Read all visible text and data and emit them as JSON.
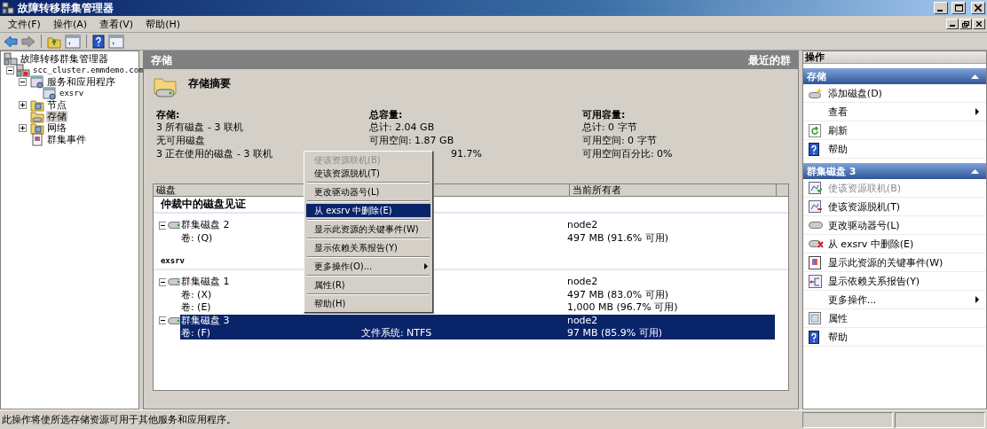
{
  "window": {
    "title": "故障转移群集管理器"
  },
  "menu_bar": [
    "文件(F)",
    "操作(A)",
    "查看(V)",
    "帮助(H)"
  ],
  "tree": [
    {
      "label": "故障转移群集管理器",
      "kind": "manager",
      "selected": false,
      "children": [
        {
          "label": "scc_cluster.emmdemo.com",
          "kind": "cluster",
          "selected": false,
          "expanded": true,
          "children": [
            {
              "label": "服务和应用程序",
              "kind": "services",
              "selected": false,
              "expanded": true,
              "children": [
                {
                  "label": "exsrv",
                  "kind": "service",
                  "selected": false
                }
              ]
            },
            {
              "label": "节点",
              "kind": "nodes",
              "selected": false,
              "expanded": false
            },
            {
              "label": "存储",
              "kind": "storage",
              "selected": true
            },
            {
              "label": "网络",
              "kind": "network",
              "selected": false,
              "expanded": false
            },
            {
              "label": "群集事件",
              "kind": "events",
              "selected": false
            }
          ]
        }
      ]
    }
  ],
  "center": {
    "title": "存储",
    "subtitle": "最近的群",
    "summary_title": "存储摘要",
    "summary_columns": [
      {
        "heading": "存储:",
        "lines": [
          "3 所有磁盘 - 3 联机",
          "无可用磁盘",
          "3 正在使用的磁盘 - 3 联机"
        ]
      },
      {
        "heading": "总容量:",
        "lines": [
          "总计: 2.04 GB",
          "可用空间: 1.87 GB",
          "91.7%"
        ]
      },
      {
        "heading": "可用容量:",
        "lines": [
          "总计: 0 字节",
          "可用空间: 0 字节",
          "可用空间百分比: 0%"
        ]
      }
    ],
    "table": {
      "columns": [
        "磁盘",
        "当前所有者"
      ],
      "groups": [
        {
          "title": "仲裁中的磁盘见证",
          "rows": [
            {
              "kind": "disk",
              "name": "群集磁盘 2",
              "owner": "node2",
              "expanded": true,
              "selected": false
            },
            {
              "kind": "volume",
              "name": "卷: (Q)",
              "owner": "497 MB (91.6% 可用)",
              "selected": false
            }
          ]
        },
        {
          "title": "exsrv",
          "rows": [
            {
              "kind": "disk",
              "name": "群集磁盘 1",
              "owner": "node2",
              "expanded": true,
              "selected": false
            },
            {
              "kind": "volume",
              "name": "卷: (X)",
              "owner": "497 MB (83.0% 可用)",
              "selected": false
            },
            {
              "kind": "volume",
              "name": "卷: (E)",
              "owner": "1,000 MB (96.7% 可用)",
              "selected": false
            },
            {
              "kind": "disk",
              "name": "群集磁盘 3",
              "owner": "node2",
              "expanded": true,
              "selected": true
            },
            {
              "kind": "volume",
              "name": "卷: (F)",
              "status": "文件系统: NTFS",
              "owner": "97 MB (85.9% 可用)",
              "selected": true
            }
          ]
        }
      ]
    }
  },
  "context_menu": [
    [
      {
        "label": "使该资源联机(B)",
        "disabled": true,
        "selected": false,
        "submenu": false
      },
      {
        "label": "使该资源脱机(T)",
        "disabled": false,
        "selected": false,
        "submenu": false
      }
    ],
    [
      {
        "label": "更改驱动器号(L)",
        "disabled": false,
        "selected": false,
        "submenu": false
      }
    ],
    [
      {
        "label": "从 exsrv 中删除(E)",
        "disabled": false,
        "selected": true,
        "submenu": false
      }
    ],
    [
      {
        "label": "显示此资源的关键事件(W)",
        "disabled": false,
        "selected": false,
        "submenu": false
      }
    ],
    [
      {
        "label": "显示依赖关系报告(Y)",
        "disabled": false,
        "selected": false,
        "submenu": false
      }
    ],
    [
      {
        "label": "更多操作(O)...",
        "disabled": false,
        "selected": false,
        "submenu": true
      }
    ],
    [
      {
        "label": "属性(R)",
        "disabled": false,
        "selected": false,
        "submenu": false
      }
    ],
    [
      {
        "label": "帮助(H)",
        "disabled": false,
        "selected": false,
        "submenu": false
      }
    ]
  ],
  "actions": {
    "title": "操作",
    "sections": [
      {
        "title": "存储",
        "expanded": true,
        "items": [
          {
            "label": "添加磁盘(D)",
            "kind": "add-disk",
            "disabled": false,
            "submenu": false
          },
          {
            "label": "查看",
            "kind": "plain",
            "disabled": false,
            "submenu": true
          },
          {
            "label": "刷新",
            "kind": "refresh",
            "disabled": false,
            "submenu": false
          },
          {
            "label": "帮助",
            "kind": "help",
            "disabled": false,
            "submenu": false
          }
        ]
      },
      {
        "title": "群集磁盘 3",
        "expanded": true,
        "items": [
          {
            "label": "使该资源联机(B)",
            "kind": "online",
            "disabled": true,
            "submenu": false
          },
          {
            "label": "使该资源脱机(T)",
            "kind": "offline",
            "disabled": false,
            "submenu": false
          },
          {
            "label": "更改驱动器号(L)",
            "kind": "drive",
            "disabled": false,
            "submenu": false
          },
          {
            "label": "从 exsrv 中删除(E)",
            "kind": "remove",
            "disabled": false,
            "submenu": false
          },
          {
            "label": "显示此资源的关键事件(W)",
            "kind": "events",
            "disabled": false,
            "submenu": false
          },
          {
            "label": "显示依赖关系报告(Y)",
            "kind": "dependency",
            "disabled": false,
            "submenu": false
          },
          {
            "label": "更多操作...",
            "kind": "plain",
            "disabled": false,
            "submenu": true
          },
          {
            "label": "属性",
            "kind": "properties",
            "disabled": false,
            "submenu": false
          },
          {
            "label": "帮助",
            "kind": "help",
            "disabled": false,
            "submenu": false
          }
        ]
      }
    ]
  },
  "status_bar": "此操作将使所选存储资源可用于其他服务和应用程序。"
}
